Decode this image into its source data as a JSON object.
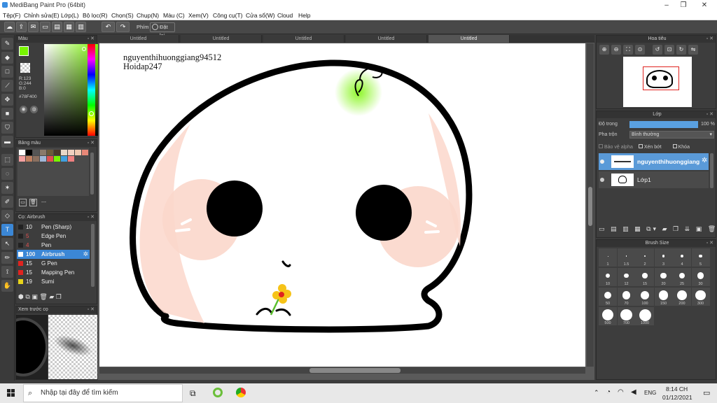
{
  "window": {
    "title": "MediBang Paint Pro (64bit)"
  },
  "menu": [
    "Tệp(F)",
    "Chỉnh sửa(E)",
    "Lớp(L)",
    "Bộ lọc(R)",
    "Chọn(S)",
    "Chụp(N)",
    "Màu (C)",
    "Xem(V)",
    "Công cụ(T)",
    "Cửa sổ(W)",
    "Cloud",
    "Help"
  ],
  "toolbar": {
    "snap_label": "Phím",
    "reset_label": "Đặt lại"
  },
  "color_panel": {
    "title": "Màu",
    "r": "R:123",
    "g": "G:244",
    "b": "B:0",
    "hex": "#78F400",
    "fg": "#78f400",
    "bg": "#e0231f"
  },
  "palette_panel": {
    "title": "Bảng màu",
    "value": "---"
  },
  "brush_panel": {
    "title": "Cọ: Airbrush",
    "items": [
      {
        "size": "10",
        "name": "Pen (Sharp)",
        "color": "#222222"
      },
      {
        "size": "5",
        "name": "Edge Pen",
        "color": "#222222"
      },
      {
        "size": "4",
        "name": "Pen",
        "color": "#222222"
      },
      {
        "size": "100",
        "name": "Airbrush",
        "color": "#ffffff"
      },
      {
        "size": "15",
        "name": "G Pen",
        "color": "#e0231f"
      },
      {
        "size": "15",
        "name": "Mapping Pen",
        "color": "#e0231f"
      },
      {
        "size": "19",
        "name": "Sumi",
        "color": "#e8d41a"
      }
    ]
  },
  "preview_panel": {
    "title": "Xem trước cọ"
  },
  "tabs": [
    "Untitled",
    "Untitled",
    "Untitled",
    "Untitled",
    "Untitled"
  ],
  "canvas": {
    "text_line1": "nguyenthihuonggiang94512",
    "text_line2": "Hoidap247"
  },
  "navigator": {
    "title": "Hoa tiêu"
  },
  "layer_panel": {
    "title": "Lớp",
    "opacity_label": "Độ trong",
    "opacity_value": "100 %",
    "blend_label": "Pha trộn",
    "blend_value": "Bình thường",
    "protect_alpha": "Bảo vệ alpha",
    "clipping": "Xén bớt",
    "lock": "Khóa",
    "layers": [
      {
        "name": "nguyenthihuonggiang"
      },
      {
        "name": "Lớp1"
      }
    ]
  },
  "brush_size": {
    "title": "Brush Size",
    "sizes": [
      "1",
      "1.5",
      "2",
      "3",
      "4",
      "5",
      "10",
      "12",
      "15",
      "20",
      "25",
      "30",
      "50",
      "70",
      "100",
      "150",
      "200",
      "300",
      "500",
      "700",
      "1000"
    ]
  },
  "taskbar": {
    "search_placeholder": "Nhập tại đây để tìm kiếm",
    "language": "ENG",
    "time": "8:14 CH",
    "date": "01/12/2021"
  }
}
